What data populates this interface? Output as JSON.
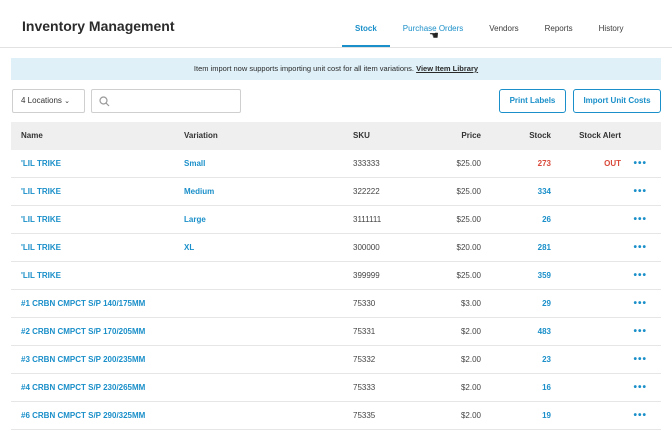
{
  "header": {
    "title": "Inventory Management",
    "tabs": [
      {
        "label": "Stock"
      },
      {
        "label": "Purchase Orders"
      },
      {
        "label": "Vendors"
      },
      {
        "label": "Reports"
      },
      {
        "label": "History"
      }
    ]
  },
  "banner": {
    "text": "Item import now supports importing unit cost for all item variations.",
    "link": "View Item Library"
  },
  "toolbar": {
    "locations": "4 Locations",
    "search_value": "",
    "search_placeholder": "",
    "print_labels": "Print Labels",
    "import_unit_costs": "Import Unit Costs"
  },
  "table": {
    "columns": {
      "name": "Name",
      "variation": "Variation",
      "sku": "SKU",
      "price": "Price",
      "stock": "Stock",
      "alert": "Stock Alert"
    },
    "rows": [
      {
        "name": "'LIL TRIKE",
        "variation": "Small",
        "sku": "333333",
        "price": "$25.00",
        "stock": "273",
        "alert": "OUT"
      },
      {
        "name": "'LIL TRIKE",
        "variation": "Medium",
        "sku": "322222",
        "price": "$25.00",
        "stock": "334",
        "alert": ""
      },
      {
        "name": "'LIL TRIKE",
        "variation": "Large",
        "sku": "3111111",
        "price": "$25.00",
        "stock": "26",
        "alert": ""
      },
      {
        "name": "'LIL TRIKE",
        "variation": "XL",
        "sku": "300000",
        "price": "$20.00",
        "stock": "281",
        "alert": ""
      },
      {
        "name": "'LIL TRIKE",
        "variation": "",
        "sku": "399999",
        "price": "$25.00",
        "stock": "359",
        "alert": ""
      },
      {
        "name": "#1 CRBN CMPCT S/P 140/175MM",
        "variation": "",
        "sku": "75330",
        "price": "$3.00",
        "stock": "29",
        "alert": ""
      },
      {
        "name": "#2 CRBN CMPCT S/P 170/205MM",
        "variation": "",
        "sku": "75331",
        "price": "$2.00",
        "stock": "483",
        "alert": ""
      },
      {
        "name": "#3 CRBN CMPCT S/P 200/235MM",
        "variation": "",
        "sku": "75332",
        "price": "$2.00",
        "stock": "23",
        "alert": ""
      },
      {
        "name": "#4 CRBN CMPCT S/P 230/265MM",
        "variation": "",
        "sku": "75333",
        "price": "$2.00",
        "stock": "16",
        "alert": ""
      },
      {
        "name": "#6 CRBN CMPCT S/P 290/325MM",
        "variation": "",
        "sku": "75335",
        "price": "$2.00",
        "stock": "19",
        "alert": ""
      }
    ]
  },
  "icons": {
    "search": "search-icon",
    "chevron": "chevron-down-icon",
    "more": "more-icon",
    "cursor": "hand-cursor-icon"
  },
  "colors": {
    "accent": "#1a8fc9",
    "alert": "#d9493a",
    "banner": "#dff0f8"
  }
}
